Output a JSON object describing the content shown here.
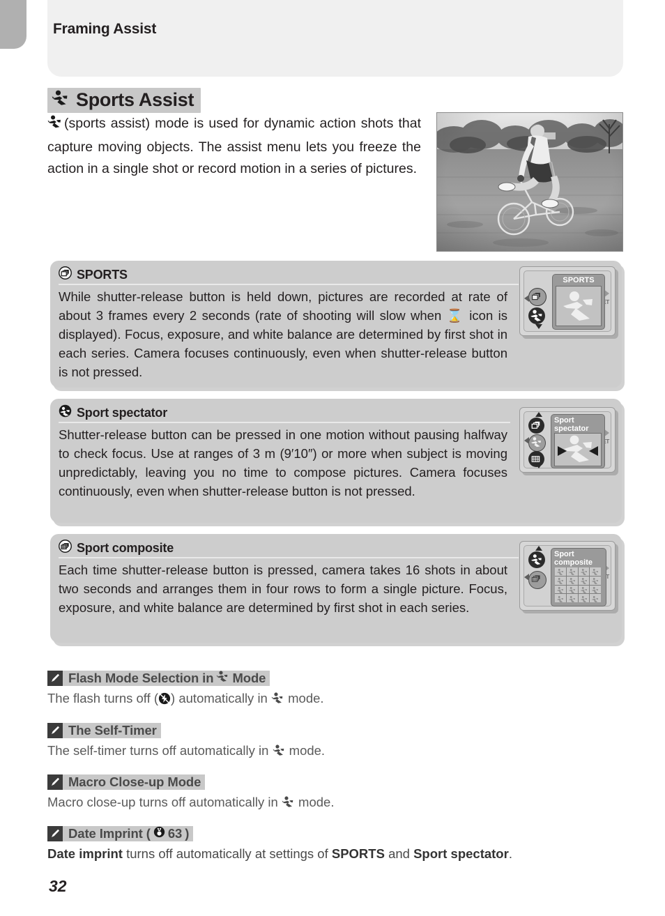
{
  "header": {
    "chapter_tab": "",
    "title": "Framing Assist"
  },
  "section": {
    "icon": "sports-runner-icon",
    "title": "Sports Assist",
    "intro": "(sports assist) mode is used for dynamic action shots that capture moving objects.  The assist menu lets you freeze the action in a single shot or record motion in a series of pictures.",
    "photo_alt": "cyclist-on-grass-photo"
  },
  "modes": [
    {
      "id": "sports",
      "icon": "continuous-frames-icon",
      "label": "SPORTS",
      "body": "While shutter-release button is held down, pictures are recorded at rate of about 3 frames every 2 seconds (rate of shooting will slow when ⌛ icon is displayed).  Focus, exposure, and white balance are determined by first shot in each series.  Camera focuses continuously, even when shutter-release button is not pressed.",
      "lcd": {
        "card_title": "SPORTS",
        "set_label": "SET",
        "left_icons": [
          "continuous-frames-icon",
          "sport-spectator-icon"
        ],
        "arrows": [
          "left",
          "right",
          "down"
        ]
      }
    },
    {
      "id": "spectator",
      "icon": "sport-spectator-icon",
      "label": "Sport spectator",
      "body": "Shutter-release button can be pressed in one motion without pausing halfway to check focus.  Use at ranges of 3 m (9′10″) or more when subject is moving unpredictably, leaving you no time to compose pictures.  Camera focuses continuously, even when shutter-release button is not pressed.",
      "lcd": {
        "card_title": "Sport spectator",
        "set_label": "SET",
        "left_icons": [
          "continuous-frames-icon",
          "sport-spectator-icon",
          "sport-composite-icon"
        ],
        "arrows": [
          "up",
          "left",
          "right",
          "down"
        ]
      }
    },
    {
      "id": "composite",
      "icon": "sport-composite-icon",
      "label": "Sport composite",
      "body": "Each time shutter-release button is pressed, camera takes 16 shots in about two seconds and arranges them in four rows to form a single picture.  Focus, exposure, and white balance are determined by first shot in each series.",
      "lcd": {
        "card_title": "Sport composite",
        "set_label": "SET",
        "grid_cells": 16,
        "left_icons": [
          "sport-spectator-icon",
          "sport-composite-icon"
        ],
        "arrows": [
          "up",
          "left",
          "right"
        ]
      }
    }
  ],
  "notes": [
    {
      "id": "flash",
      "icon": "pencil-note-icon",
      "title_pre": "Flash Mode Selection in",
      "title_post": "Mode",
      "has_title_icon": true,
      "body_pre": "The flash turns off (",
      "body_mid": ") automatically in",
      "body_post": "mode."
    },
    {
      "id": "selftimer",
      "icon": "pencil-note-icon",
      "title_pre": "The Self-Timer",
      "title_post": "",
      "has_title_icon": false,
      "body_pre": "The self-timer turns off automatically in",
      "body_post": "mode."
    },
    {
      "id": "macro",
      "icon": "pencil-note-icon",
      "title_pre": "Macro Close-up Mode",
      "title_post": "",
      "has_title_icon": false,
      "body_pre": "Macro close-up turns off automatically in",
      "body_post": "mode."
    },
    {
      "id": "date",
      "icon": "pencil-note-icon",
      "title_pre": "Date Imprint (",
      "title_ref_icon": "page-reference-icon",
      "title_ref_page": "63",
      "title_post": ")",
      "has_title_icon": false,
      "body_bold_1": "Date imprint",
      "body_mid_1": " turns off automatically at settings of ",
      "body_bold_2": "SPORTS",
      "body_mid_2": " and ",
      "body_bold_3": "Sport spectator",
      "body_end": "."
    }
  ],
  "page_number": "32",
  "colors": {
    "panel_bg": "#cdcdcd",
    "header_band": "#f0f0f0",
    "tab": "#b0b0b0",
    "highlight": "#c8c8c8",
    "text": "#231f20",
    "note_text": "#5a5a5a",
    "lcd_card": "#9a9a9a"
  }
}
